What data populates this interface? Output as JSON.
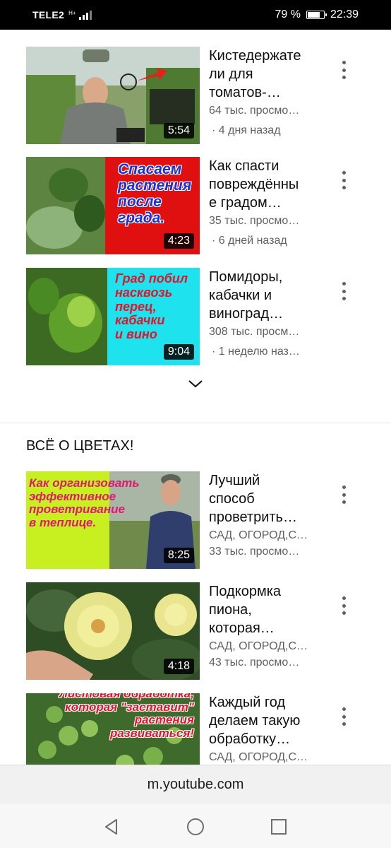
{
  "status": {
    "carrier": "TELE2",
    "network": "H+",
    "battery_percent": "79 %",
    "battery_level": 0.79,
    "time": "22:39"
  },
  "videos": [
    {
      "title_lines": [
        "Кистедержате",
        "ли для",
        "томатов-…"
      ],
      "views": "64 тыс. просмо…",
      "age": "· 4 дня назад",
      "duration": "5:54"
    },
    {
      "title_lines": [
        "Как спасти",
        "повреждённы",
        "е градом…"
      ],
      "views": "35 тыс. просмо…",
      "age": "· 6 дней назад",
      "duration": "4:23",
      "thumb_text": [
        "Спасаем",
        "растения",
        "после",
        "града."
      ]
    },
    {
      "title_lines": [
        "Помидоры,",
        "кабачки и",
        "виноград…"
      ],
      "views": "308 тыс. просм…",
      "age": "· 1 неделю наз…",
      "duration": "9:04",
      "thumb_text": [
        "Град побил",
        "насквозь",
        "перец,",
        "кабачки",
        "и вино"
      ]
    }
  ],
  "section": {
    "title": "ВСЁ О ЦВЕТАХ!"
  },
  "section_videos": [
    {
      "title_lines": [
        "Лучший",
        "способ",
        "проветрить…"
      ],
      "channel": "САД, ОГОРОД,С…",
      "views": "33 тыс. просмо…",
      "duration": "8:25",
      "thumb_text": [
        "Как организовать",
        "эффективное",
        "проветривание",
        "в теплице."
      ]
    },
    {
      "title_lines": [
        "Подкормка",
        "пиона,",
        "которая…"
      ],
      "channel": "САД, ОГОРОД,С…",
      "views": "43 тыс. просмо…",
      "duration": "4:18"
    },
    {
      "title_lines": [
        "Каждый год",
        "делаем такую",
        "обработку…"
      ],
      "channel": "САД, ОГОРОД,С…",
      "thumb_text": [
        "Листовая обработка,",
        "которая \"заставит\"",
        "растения",
        "развиваться!"
      ]
    }
  ],
  "url_bar": {
    "url": "m.youtube.com"
  },
  "colors": {
    "thumb2_panel": "#e11010",
    "thumb3_panel": "#1ee3ee",
    "thumb4_panel": "#c8f021",
    "secondary_text": "#606060"
  }
}
